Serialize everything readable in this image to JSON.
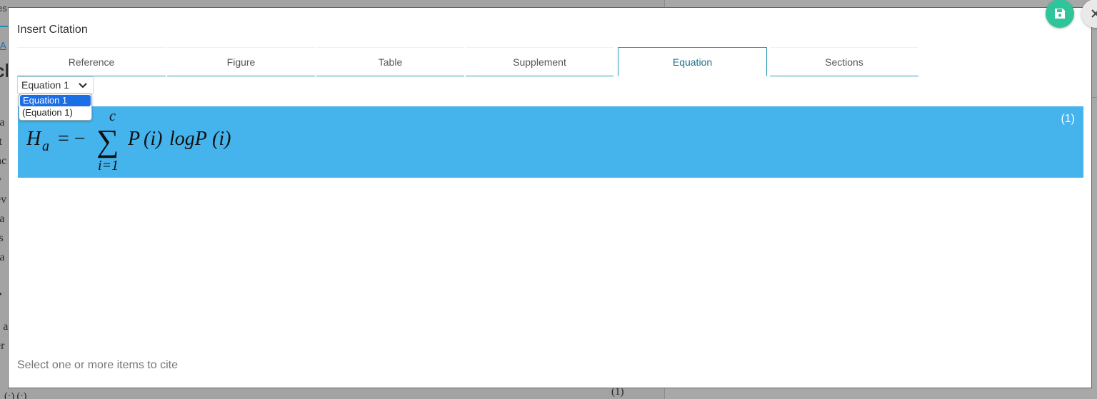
{
  "background": {
    "tab_fragment": "es",
    "link_fragment": "A",
    "heading_fragment": "ch",
    "heading2_fragment": "r",
    "text_fragments": [
      "s",
      "ra",
      "it",
      "nc",
      "y",
      "ev",
      "ra",
      "ts",
      "ra"
    ],
    "text_fragments_2": [
      "s a",
      "er"
    ],
    "bottom_number": "(1)",
    "bottom_left": "(·)  (·)"
  },
  "modal": {
    "title": "Insert Citation",
    "tabs": [
      {
        "label": "Reference"
      },
      {
        "label": "Figure"
      },
      {
        "label": "Table"
      },
      {
        "label": "Supplement"
      },
      {
        "label": "Equation"
      },
      {
        "label": "Sections"
      }
    ],
    "active_tab": "Equation",
    "select": {
      "value": "Equation 1",
      "options": [
        "Equation 1",
        "(Equation 1)"
      ]
    },
    "equation": {
      "latex": "H_a = -\\sum_{i=1}^{c} P(i)\\, log P(i)",
      "lhs": "H",
      "lhs_sub": "a",
      "eq_sign": "= −",
      "sum_upper": "c",
      "sum_lower": "i=1",
      "term1": "P",
      "arg1": "(i)",
      "log": "logP",
      "arg2": "(i)",
      "number": "(1)"
    },
    "hint": "Select one or more items to cite",
    "save_icon": "floppy-disk-icon",
    "close_icon": "close-icon"
  },
  "colors": {
    "accent": "#2a9bb5",
    "equation_highlight": "#45b3ec",
    "save_button": "#2fc49a",
    "dropdown_selected": "#1c6ee6"
  }
}
